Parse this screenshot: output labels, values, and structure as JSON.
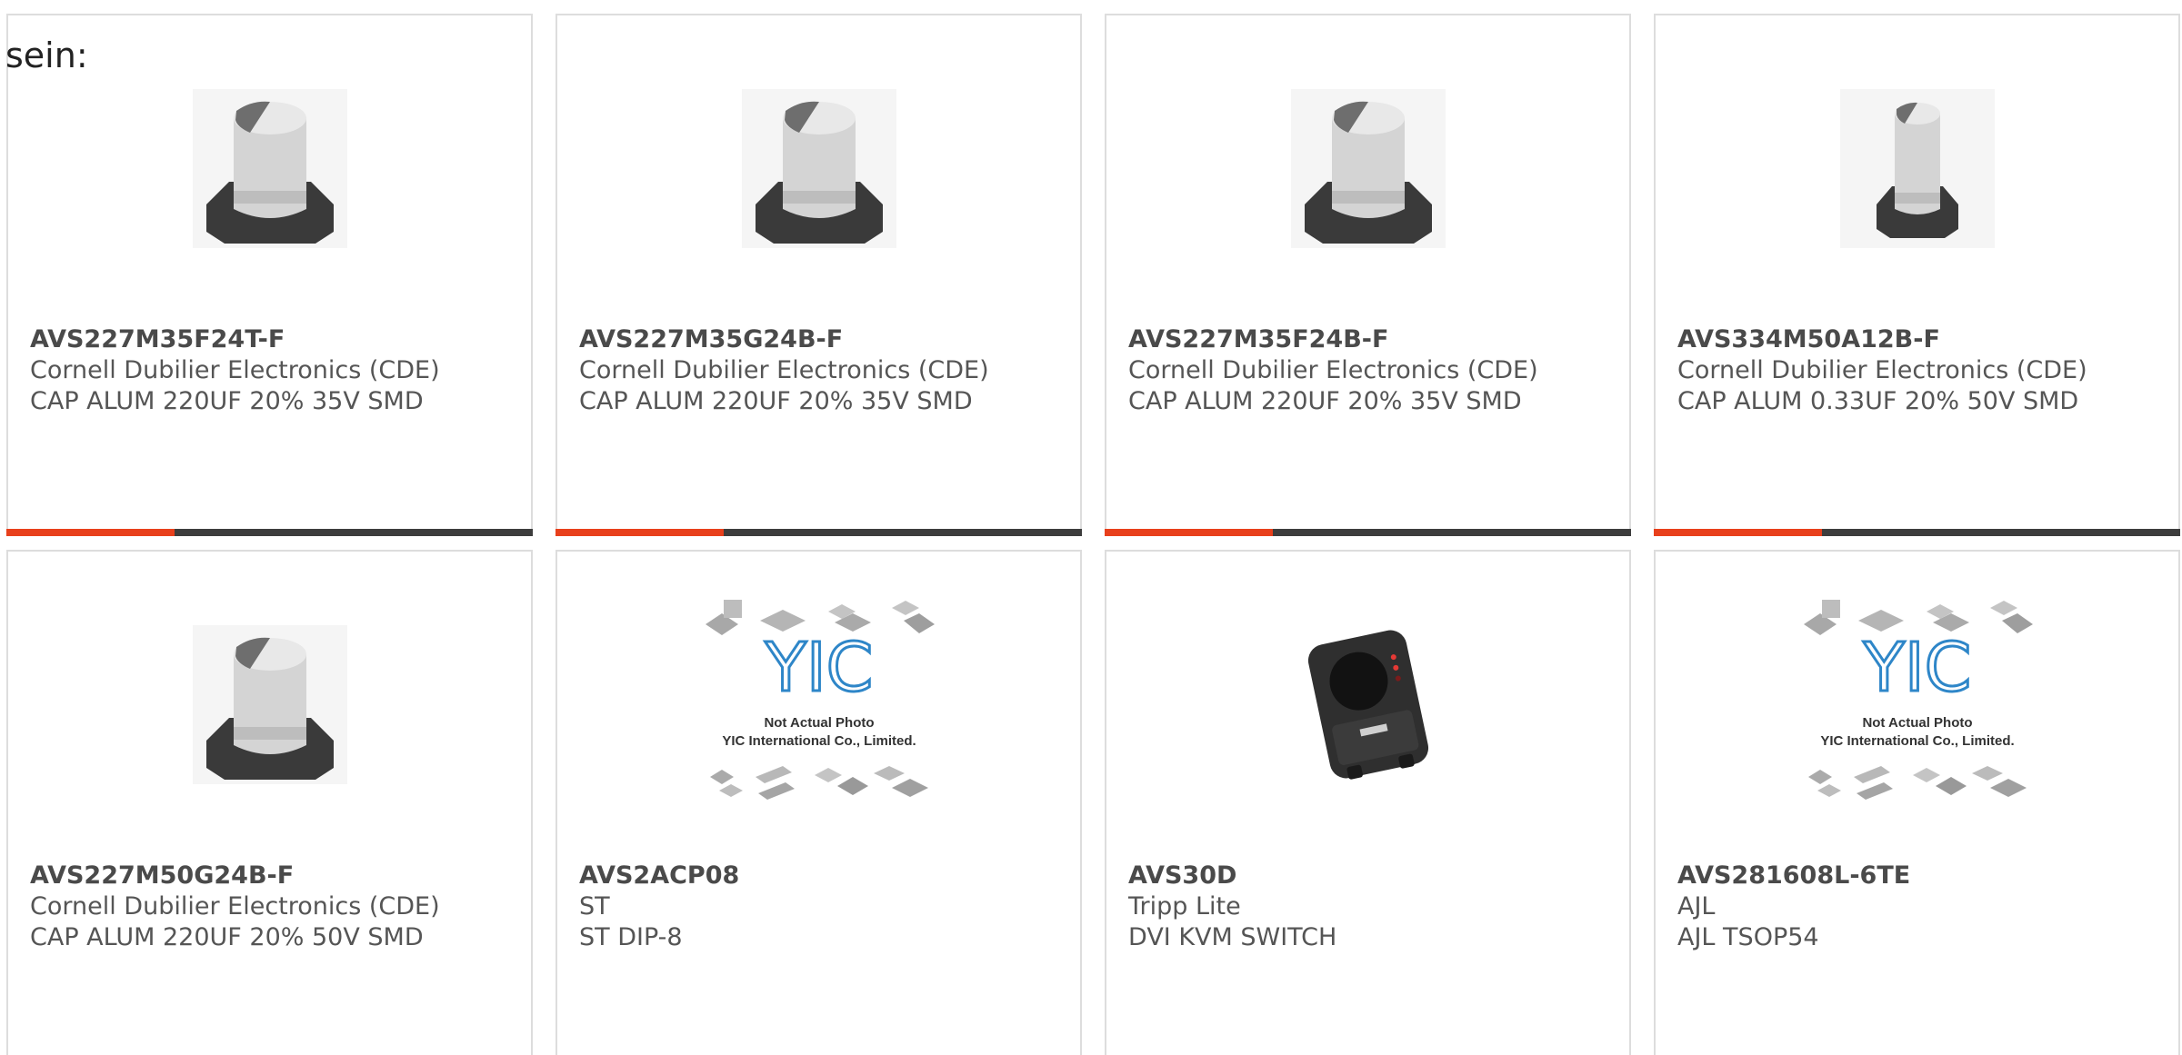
{
  "heading": "sein:",
  "products": [
    {
      "part_number": "AVS227M35F24T-F",
      "manufacturer": "Cornell Dubilier Electronics (CDE)",
      "description": "CAP ALUM 220UF 20% 35V SMD",
      "image_icon": "capacitor-icon",
      "progress": 0.32
    },
    {
      "part_number": "AVS227M35G24B-F",
      "manufacturer": "Cornell Dubilier Electronics (CDE)",
      "description": "CAP ALUM 220UF 20% 35V SMD",
      "image_icon": "capacitor-icon",
      "progress": 0.32
    },
    {
      "part_number": "AVS227M35F24B-F",
      "manufacturer": "Cornell Dubilier Electronics (CDE)",
      "description": "CAP ALUM 220UF 20% 35V SMD",
      "image_icon": "capacitor-icon",
      "progress": 0.32
    },
    {
      "part_number": "AVS334M50A12B-F",
      "manufacturer": "Cornell Dubilier Electronics (CDE)",
      "description": "CAP ALUM 0.33UF 20% 50V SMD",
      "image_icon": "capacitor-small-icon",
      "progress": 0.32
    },
    {
      "part_number": "AVS227M50G24B-F",
      "manufacturer": "Cornell Dubilier Electronics (CDE)",
      "description": "CAP ALUM 220UF 20% 50V SMD",
      "image_icon": "capacitor-icon"
    },
    {
      "part_number": "AVS2ACP08",
      "manufacturer": "ST",
      "description": "ST DIP-8",
      "image_icon": "placeholder-chips-icon",
      "placeholder_caption_1": "Not Actual Photo",
      "placeholder_caption_2": "YIC International Co., Limited."
    },
    {
      "part_number": "AVS30D",
      "manufacturer": "Tripp Lite",
      "description": "DVI KVM SWITCH",
      "image_icon": "kvm-switch-icon"
    },
    {
      "part_number": "AVS281608L-6TE",
      "manufacturer": "AJL",
      "description": "AJL TSOP54",
      "image_icon": "placeholder-chips-icon",
      "placeholder_caption_1": "Not Actual Photo",
      "placeholder_caption_2": "YIC International Co., Limited."
    }
  ],
  "colors": {
    "accent": "#e8401c",
    "progress_track": "#3d3d3d",
    "border": "#dddddd",
    "text": "#555555"
  }
}
